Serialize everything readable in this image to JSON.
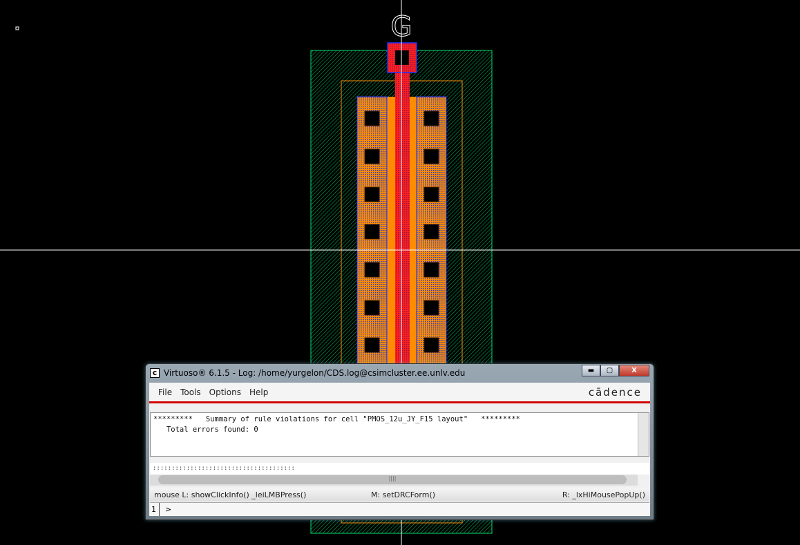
{
  "layout": {
    "pin_label": "G",
    "colors": {
      "nwell": "#00e070",
      "pimplant": "#ff8c00",
      "diffusion": "#ff8c00",
      "poly": "#ff2020",
      "metal1": "#2030ff",
      "contact": "#000000",
      "crosshair": "#ffffff"
    }
  },
  "window": {
    "title": "Virtuoso® 6.1.5 - Log: /home/yurgelon/CDS.log@csimcluster.ee.unlv.edu",
    "app_icon": "c",
    "menu": [
      "File",
      "Tools",
      "Options",
      "Help"
    ],
    "brand": "cādence",
    "log_lines": [
      "*********   Summary of rule violations for cell \"PMOS_12u_JY_F15 layout\"   *********",
      "   Total errors found: 0"
    ],
    "command_input": "::::::::::::::::::::::::::::::::::::::",
    "status": {
      "left": "mouse L: showClickInfo() _leiLMBPress()",
      "middle": "M: setDRCForm()",
      "right": "R: _lxHiMousePopUp()"
    },
    "prompt": {
      "line_number": "1",
      "symbol": ">"
    }
  }
}
